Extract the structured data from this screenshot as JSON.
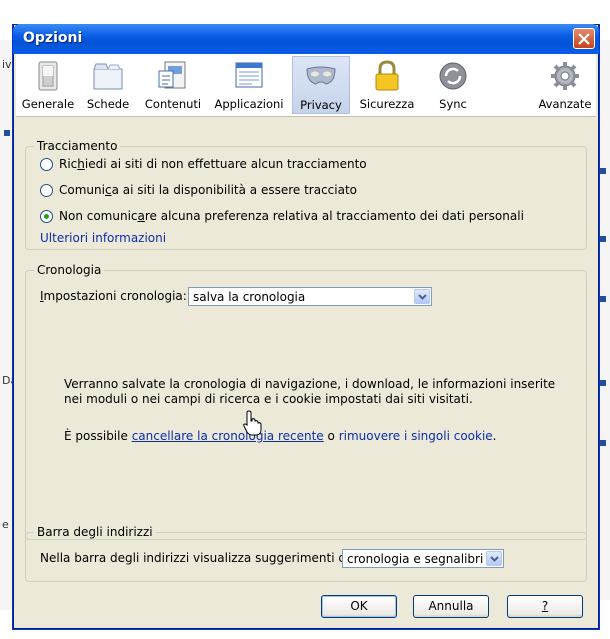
{
  "window": {
    "title": "Opzioni"
  },
  "toolbar": {
    "items": [
      {
        "label": "Generale",
        "icon": "switch-icon"
      },
      {
        "label": "Schede",
        "icon": "tabs-icon"
      },
      {
        "label": "Contenuti",
        "icon": "content-icon"
      },
      {
        "label": "Applicazioni",
        "icon": "applications-icon"
      },
      {
        "label": "Privacy",
        "icon": "mask-icon",
        "selected": true
      },
      {
        "label": "Sicurezza",
        "icon": "lock-icon"
      },
      {
        "label": "Sync",
        "icon": "sync-icon"
      },
      {
        "label": "Avanzate",
        "icon": "gear-icon"
      }
    ]
  },
  "tracking": {
    "title": "Tracciamento",
    "options": [
      {
        "pre": "Ric",
        "key": "h",
        "post": "iedi ai siti di non effettuare alcun tracciamento",
        "checked": false
      },
      {
        "pre": "Comuni",
        "key": "c",
        "post": "a ai siti la disponibilità a essere tracciato",
        "checked": false
      },
      {
        "pre": "Non comunic",
        "key": "a",
        "post": "re alcuna preferenza relativa al tracciamento dei dati personali",
        "checked": true
      }
    ],
    "more_info": "Ulteriori informazioni"
  },
  "history": {
    "title": "Cronologia",
    "settings_label_key": "I",
    "settings_label_rest": "mpostazioni cronologia:",
    "settings_value": "salva la cronologia",
    "description": "Verranno salvate la cronologia di navigazione, i download, le informazioni inserite nei moduli o nei campi di ricerca e i cookie impostati dai siti visitati.",
    "possible_text": "È possibile ",
    "clear_link": "cancellare la cronologia recente",
    "or_text": " o ",
    "cookies_link": "rimuovere i singoli cookie",
    "end_text": "."
  },
  "address_bar": {
    "title": "Barra degli indirizzi",
    "suggest_label": "Nella barra degli indirizzi visualizza suggerimenti da:",
    "suggest_value": "cronologia e segnalibri"
  },
  "buttons": {
    "ok": "OK",
    "cancel": "Annulla",
    "help": "?"
  },
  "background": {
    "left_marks": [
      "iv",
      "Da",
      "e"
    ]
  },
  "colors": {
    "titlebar": "#0a5ce8",
    "dialog_bg": "#ece9d8",
    "link": "#0b2ea8",
    "radio_dot": "#21a121"
  }
}
